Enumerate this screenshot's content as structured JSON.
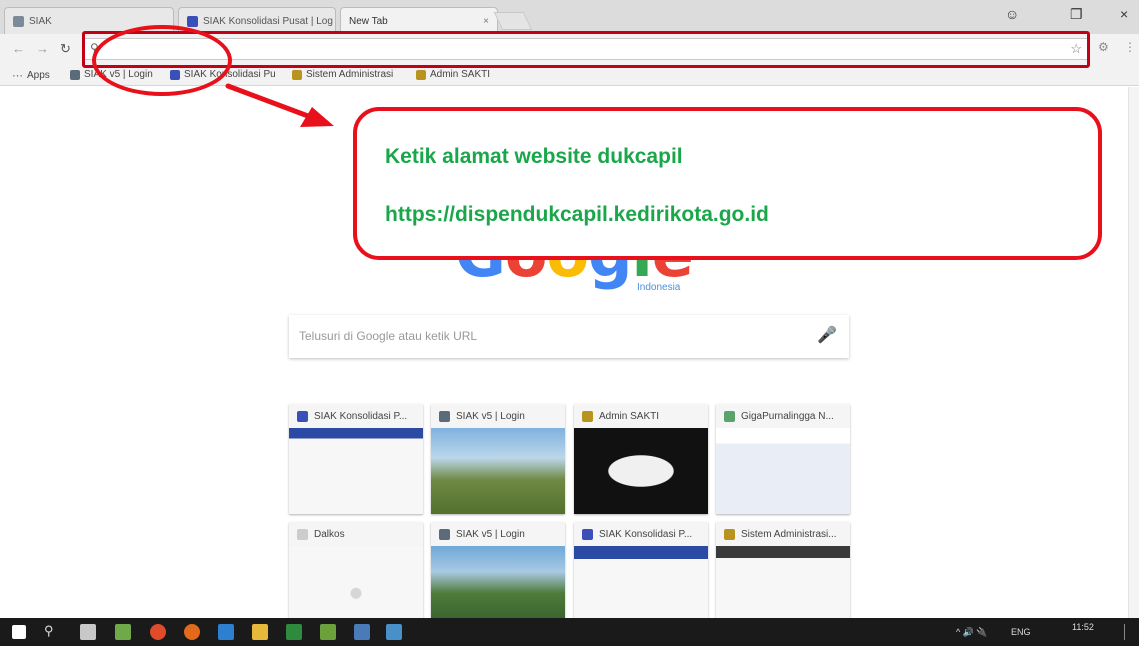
{
  "tabs": [
    {
      "label": "SIAK",
      "active": false
    },
    {
      "label": "SIAK Konsolidasi Pusat | Log",
      "active": false
    },
    {
      "label": "New Tab",
      "active": true
    }
  ],
  "omnibox": {
    "value": ""
  },
  "bookmarks": {
    "apps_label": "Apps",
    "items": [
      "SIAK v5 | Login",
      "SIAK Konsolidasi Pu",
      "Sistem Administrasi",
      "Admin SAKTI"
    ]
  },
  "google": {
    "logo_letters": [
      "G",
      "o",
      "o",
      "g",
      "l",
      "e"
    ],
    "logo_colors": [
      "#4285f4",
      "#ea4335",
      "#fbbc05",
      "#4285f4",
      "#34a853",
      "#ea4335"
    ],
    "sub": "Indonesia",
    "search_placeholder": "Telusuri di Google atau ketik URL"
  },
  "tiles": [
    {
      "title": "SIAK Konsolidasi P...",
      "fav_color": "#3b4fb8"
    },
    {
      "title": "SIAK v5 | Login",
      "fav_color": "#5b6b7a"
    },
    {
      "title": "Admin SAKTI",
      "fav_color": "#b8941f"
    },
    {
      "title": "GigaPurnalingga N...",
      "fav_color": "#5aa36b"
    },
    {
      "title": "Dalkos",
      "fav_color": "#cccccc"
    },
    {
      "title": "SIAK v5 | Login",
      "fav_color": "#5b6b7a"
    },
    {
      "title": "SIAK Konsolidasi P...",
      "fav_color": "#3b4fb8"
    },
    {
      "title": "Sistem Administrasi...",
      "fav_color": "#b8941f"
    }
  ],
  "callout": {
    "line1": "Ketik alamat website dukcapil",
    "line2": "https://dispendukcapil.kedirikota.go.id"
  },
  "tray": {
    "lang": "ENG",
    "time": "11:52"
  },
  "colors": {
    "annotation_red": "#e8101a",
    "callout_text": "#1aa74a"
  }
}
